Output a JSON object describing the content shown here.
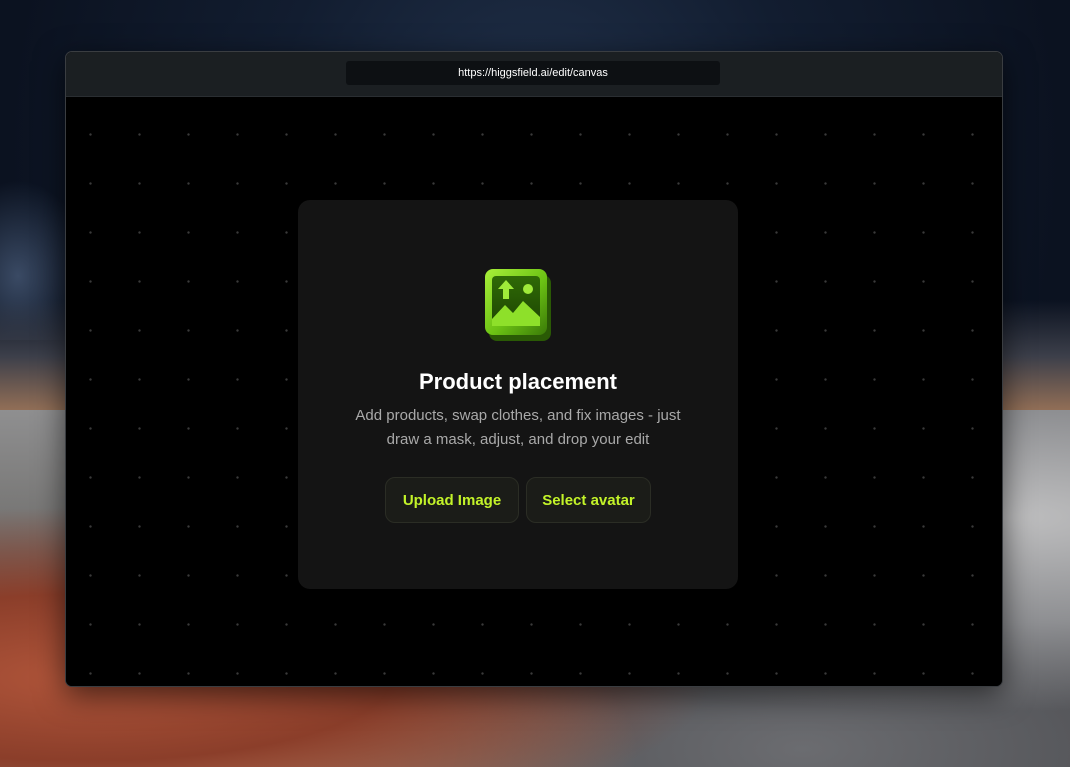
{
  "browser": {
    "url": "https://higgsfield.ai/edit/canvas"
  },
  "card": {
    "icon": "image-upload-icon",
    "title": "Product placement",
    "description": "Add products, swap clothes, and fix images - just draw a mask, adjust, and drop your edit",
    "buttons": {
      "upload_label": "Upload Image",
      "avatar_label": "Select avatar"
    }
  },
  "colors": {
    "accent": "#c3f329",
    "icon_green": "#7fd11b",
    "card_bg": "#141414",
    "canvas_bg": "#000000"
  }
}
